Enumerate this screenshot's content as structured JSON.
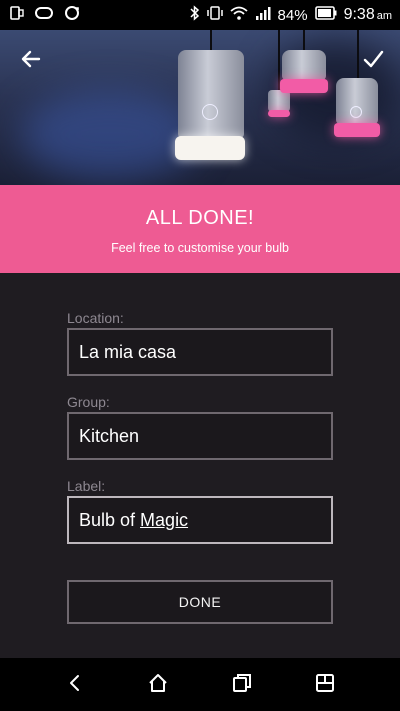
{
  "status_bar": {
    "battery_percent": "84%",
    "time": "9:38",
    "ampm": "am",
    "icons": [
      "notification-icon",
      "messenger-icon",
      "sync-icon",
      "bluetooth-icon",
      "vibrate-icon",
      "wifi-icon",
      "signal-icon",
      "battery-icon"
    ]
  },
  "hero": {
    "back_icon": "arrow-left-icon",
    "confirm_icon": "check-icon",
    "accent_color": "#f25ca6"
  },
  "banner": {
    "title": "ALL DONE!",
    "subtitle": "Feel free to customise your bulb",
    "background_color": "#ee5b93"
  },
  "form": {
    "location_label": "Location:",
    "location_value": "La mia casa",
    "group_label": "Group:",
    "group_value": "Kitchen",
    "label_label": "Label:",
    "label_value_prefix": "Bulb of",
    "label_value_underlined": "Magic",
    "done_label": "DONE"
  },
  "nav_bar": {
    "icons": [
      "back-icon",
      "home-icon",
      "recent-apps-icon",
      "multiwindow-icon"
    ]
  }
}
